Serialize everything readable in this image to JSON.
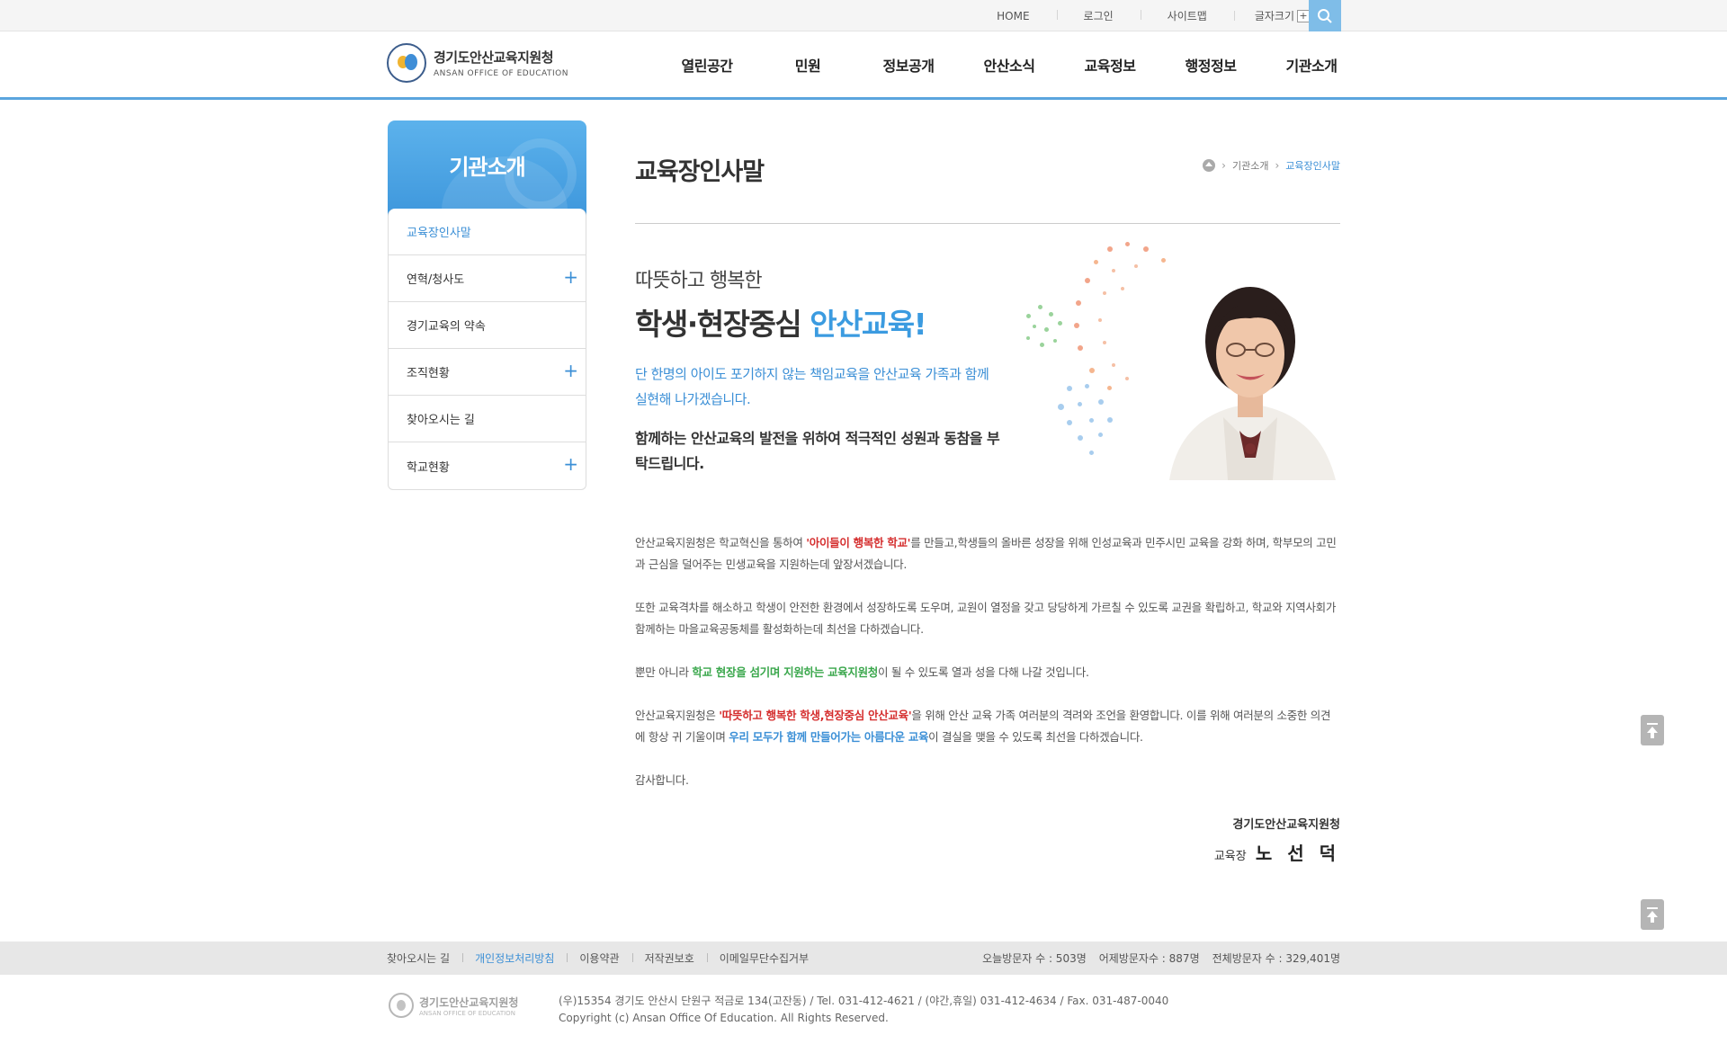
{
  "utility": {
    "links": [
      "HOME",
      "로그인",
      "사이트맵"
    ],
    "font_size_label": "글자크기",
    "font_buttons": [
      "+",
      "■",
      "−"
    ]
  },
  "logo": {
    "name_ko": "경기도안산교육지원청",
    "name_en": "ANSAN OFFICE OF EDUCATION"
  },
  "gnb": [
    "열린공간",
    "민원",
    "정보공개",
    "안산소식",
    "교육정보",
    "행정정보",
    "기관소개"
  ],
  "sidebar": {
    "title": "기관소개",
    "items": [
      {
        "label": "교육장인사말",
        "active": true,
        "expandable": false
      },
      {
        "label": "연혁/청사도",
        "active": false,
        "expandable": true
      },
      {
        "label": "경기교육의 약속",
        "active": false,
        "expandable": false
      },
      {
        "label": "조직현황",
        "active": false,
        "expandable": true
      },
      {
        "label": "찾아오시는 길",
        "active": false,
        "expandable": false
      },
      {
        "label": "학교현황",
        "active": false,
        "expandable": true
      }
    ]
  },
  "content": {
    "title": "교육장인사말",
    "breadcrumb": [
      "기관소개",
      "교육장인사말"
    ],
    "greeting_sub": "따뜻하고 행복한",
    "greeting_main_a": "학생·현장중심",
    "greeting_main_b": "안산교육!",
    "lead_1": "단 한명의 아이도 포기하지 않는 책임교육을 안산교육 가족과 함께 실현해 나가겠습니다.",
    "lead_2": "함께하는 안산교육의 발전을 위하여 적극적인 성원과 동참을 부탁드립니다.",
    "p1_a": "안산교육지원청은 학교혁신을 통하여 ",
    "p1_hl": "'아이들이 행복한 학교'",
    "p1_b": "를 만들고,학생들의 올바른 성장을 위해 인성교육과 민주시민 교육을 강화 하며, 학부모의 고민과 근심을 덜어주는 민생교육을 지원하는데 앞장서겠습니다.",
    "p2": "또한 교육격차를 해소하고 학생이 안전한 환경에서 성장하도록 도우며, 교원이 열정을 갖고 당당하게 가르칠 수 있도록 교권을 확립하고, 학교와 지역사회가 함께하는 마을교육공동체를 활성화하는데 최선을 다하겠습니다.",
    "p3_a": "뿐만 아니라 ",
    "p3_hl": "학교 현장을 섬기며 지원하는 교육지원청",
    "p3_b": "이 될 수 있도록 열과 성을 다해 나갈 것입니다.",
    "p4_a": "안산교육지원청은 ",
    "p4_hl1": "'따뜻하고 행복한 학생,현장중심 안산교육'",
    "p4_b": "을 위해 안산 교육 가족 여러분의 격려와 조언을 환영합니다. 이를 위해 여러분의 소중한 의견에 항상 귀 기울이며 ",
    "p4_hl2": "우리 모두가 함께 만들어가는 아름다운 교육",
    "p4_c": "이 결실을 맺을 수 있도록 최선을 다하겠습니다.",
    "p5": "감사합니다.",
    "sign_org": "경기도안산교육지원청",
    "sign_role": "교육장",
    "sign_name": "노 선 덕"
  },
  "footer": {
    "links": [
      {
        "label": "찾아오시는 길",
        "highlight": false
      },
      {
        "label": "개인정보처리방침",
        "highlight": true
      },
      {
        "label": "이용약관",
        "highlight": false
      },
      {
        "label": "저작권보호",
        "highlight": false
      },
      {
        "label": "이메일무단수집거부",
        "highlight": false
      }
    ],
    "visitors_today": "오늘방문자 수 : 503명",
    "visitors_yesterday": "어제방문자수 : 887명",
    "visitors_total": "전체방문자 수 : 329,401명",
    "logo_ko": "경기도안산교육지원청",
    "logo_en": "ANSAN OFFICE OF EDUCATION",
    "address": "(우)15354 경기도 안산시 단원구 적금로 134(고잔동) / Tel. 031-412-4621 / (야간,휴일) 031-412-4634 / Fax. 031-487-0040",
    "copyright": "Copyright (c) Ansan Office Of Education. All Rights Reserved."
  },
  "colors": {
    "accent": "#3b8fd6",
    "header_line": "#5ba5de",
    "highlight_red": "#d52e2e",
    "highlight_green": "#3aa74c"
  }
}
